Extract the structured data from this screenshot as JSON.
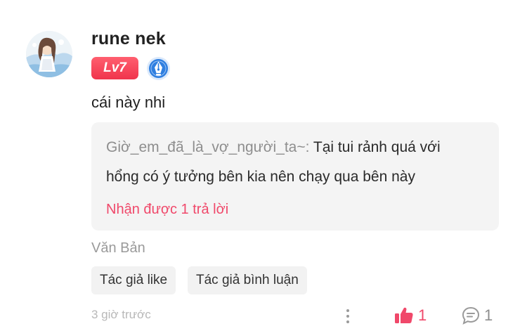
{
  "comment": {
    "author": "rune nek",
    "level_badge": "Lv7",
    "text": "cái này nhi",
    "reply_preview": {
      "author": "Giờ_em_đã_là_vợ_người_ta~",
      "separator": ":",
      "text_line1": " Tại tui rảnh quá với",
      "text_line2": "hổng có ý tưởng bên kia nên chạy qua bên này",
      "replies_link": "Nhận được 1 trả lời"
    },
    "source": "Văn Bản",
    "tags": [
      "Tác giả like",
      "Tác giả bình luận"
    ],
    "timestamp": "3 giờ trước",
    "likes": "1",
    "comments": "1"
  },
  "icons": {
    "avatar": "anime-girl-avatar",
    "verified": "verified-pen-icon",
    "more": "more-vertical-icon",
    "like": "thumbs-up-icon",
    "comment": "comment-bubble-icon"
  },
  "colors": {
    "accent": "#f0486a",
    "badge_start": "#ff5f6f",
    "badge_end": "#f0344c",
    "verified_blue": "#2f7fe0",
    "reply_bg": "#f4f4f4",
    "muted_text": "#9a9a9a"
  }
}
